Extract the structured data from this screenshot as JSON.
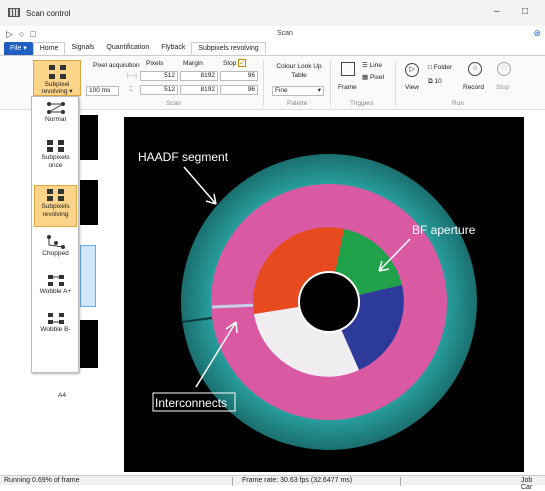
{
  "window": {
    "title": "Scan control",
    "scan_title": "Scan",
    "minimize": "–",
    "maximize": "□"
  },
  "qat": {
    "play": "▷",
    "stop": "○",
    "square": "□"
  },
  "tabs": [
    {
      "label": "File ▾"
    },
    {
      "label": "Home"
    },
    {
      "label": "Signals"
    },
    {
      "label": "Quantification"
    },
    {
      "label": "Flyback"
    },
    {
      "label": "Subpixels revolving"
    }
  ],
  "ribbon": {
    "mode_button": "Subpixel revolving ▾",
    "pixel_acq": "Pixel acquisition",
    "pixel_acq_value": "100 ms",
    "pixels": "Pixels",
    "margin": "Margin",
    "stop": "Stop",
    "stop_check": "✓",
    "h_pixels": "512",
    "h_margin": "8192",
    "h_stop": "96",
    "v_pixels": "512",
    "v_margin": "8192",
    "v_stop": "96",
    "group_scan": "Scan",
    "colour_lut": "Colour Look Up Table",
    "colour_value": "Fine",
    "group_palette": "Palette",
    "frame": "Frame",
    "line": "Line",
    "pixel": "Pixel",
    "group_triggers": "Triggers",
    "view": "View",
    "folder": "Folder",
    "count": "10",
    "record": "Record",
    "stopbtn": "Stop",
    "group_run": "Run"
  },
  "menu": {
    "items": [
      {
        "label": "Normal"
      },
      {
        "label": "Subpixels once"
      },
      {
        "label": "Subpixels revolving",
        "selected": true
      },
      {
        "label": "Chopped"
      },
      {
        "label": "Wobble A+"
      },
      {
        "label": "Wobble B-"
      }
    ]
  },
  "thumbs": {
    "a4_label": "A4"
  },
  "image": {
    "haadf": "HAADF segment",
    "bf": "BF aperture",
    "interconnects": "Interconnects"
  },
  "status": {
    "running": "Running 0.69% of frame",
    "frame_rate": "Frame rate: 30.63 fps (32.6477 ms)",
    "job": "Job Car"
  }
}
